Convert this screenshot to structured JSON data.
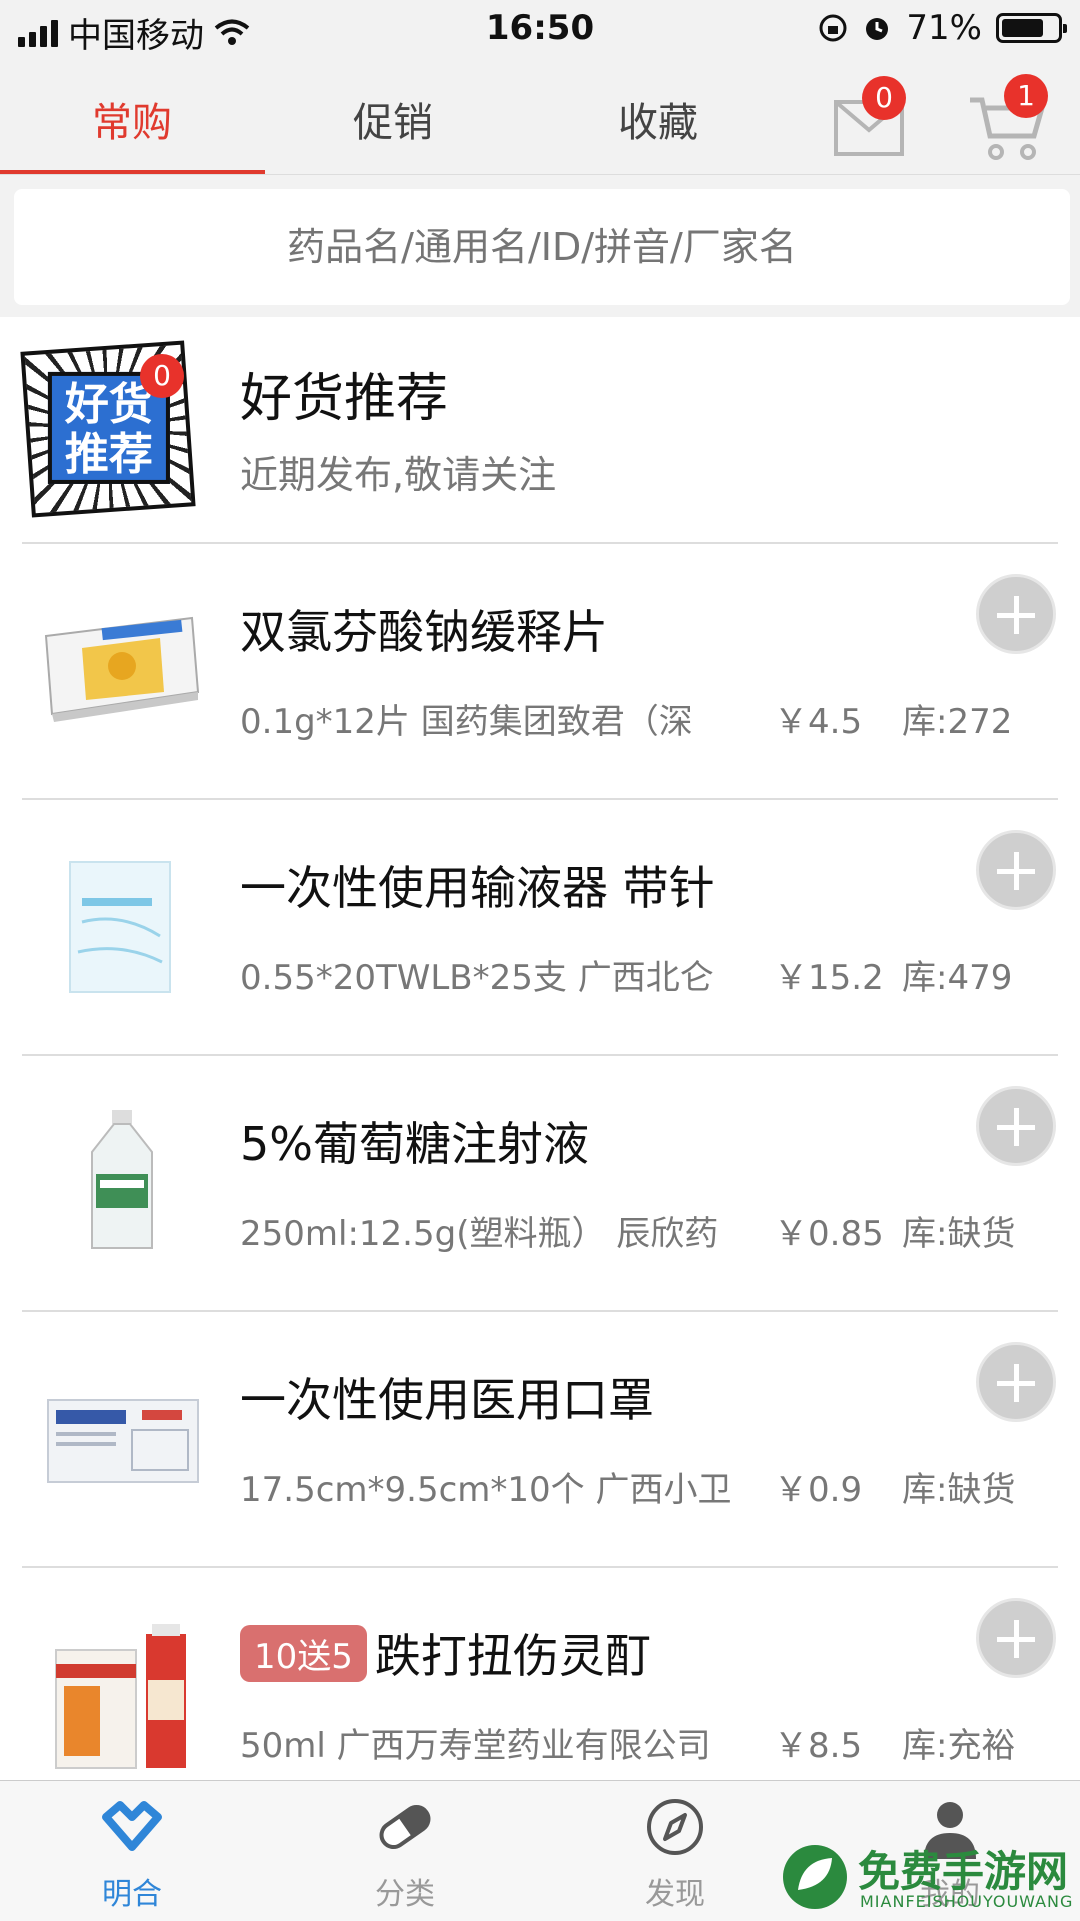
{
  "status_bar": {
    "carrier": "中国移动",
    "time": "16:50",
    "battery": "71%"
  },
  "tabs": {
    "regular": "常购",
    "promo": "促销",
    "favorites": "收藏"
  },
  "badges": {
    "messages": "0",
    "cart": "1"
  },
  "search": {
    "placeholder": "药品名/通用名/ID/拼音/厂家名"
  },
  "featured": {
    "image_text_1": "好货",
    "image_text_2": "推荐",
    "badge": "0",
    "title": "好货推荐",
    "subtitle": "近期发布,敬请关注"
  },
  "products": [
    {
      "name": "双氯芬酸钠缓释片",
      "promo": "",
      "spec": "0.1g*12片 国药集团致君（深",
      "price": "￥4.5",
      "stock": "库:272"
    },
    {
      "name": "一次性使用输液器 带针",
      "promo": "",
      "spec": "0.55*20TWLB*25支 广西北仑",
      "price": "￥15.2",
      "stock": "库:479"
    },
    {
      "name": "5%葡萄糖注射液",
      "promo": "",
      "spec": "250ml:12.5g(塑料瓶） 辰欣药",
      "price": "￥0.85",
      "stock": "库:缺货"
    },
    {
      "name": "一次性使用医用口罩",
      "promo": "",
      "spec": "17.5cm*9.5cm*10个 广西小卫",
      "price": "￥0.9",
      "stock": "库:缺货"
    },
    {
      "name": "跌打扭伤灵酊",
      "promo": "10送5",
      "spec": "50ml 广西万寿堂药业有限公司",
      "price": "￥8.5",
      "stock": "库:充裕"
    }
  ],
  "bottom_nav": {
    "home": "明合",
    "category": "分类",
    "discover": "发现",
    "mine": "我的"
  },
  "watermark": {
    "text": "免费手游网",
    "sub": "MIANFEISHOUYOUWANG"
  },
  "colors": {
    "accent_red": "#e03a2e",
    "badge_red": "#e8322b",
    "nav_blue": "#2f86d8",
    "promo_pink": "#d9706f"
  }
}
